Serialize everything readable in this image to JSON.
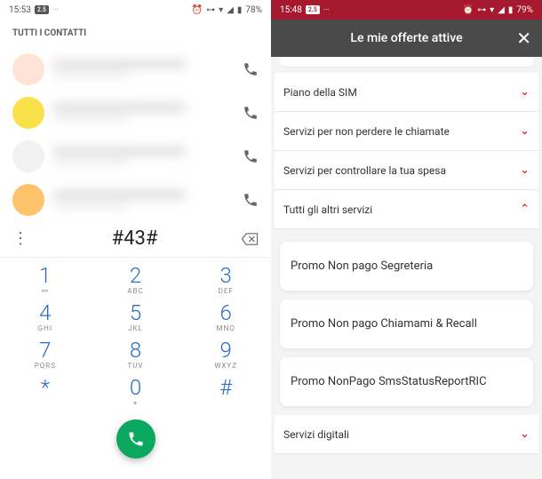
{
  "left": {
    "status": {
      "time": "15:53",
      "battery": "78%",
      "label_badge": "2.5"
    },
    "tab": "TUTTI I CONTATTI",
    "contacts": [
      {
        "color": "#ffe3d6"
      },
      {
        "color": "#f9e14a"
      },
      {
        "color": "#f2f2f2"
      },
      {
        "color": "#ffc36b"
      }
    ],
    "dial": "#43#",
    "keys": [
      [
        {
          "d": "1",
          "l": "⚯"
        },
        {
          "d": "2",
          "l": "ABC"
        },
        {
          "d": "3",
          "l": "DEF"
        }
      ],
      [
        {
          "d": "4",
          "l": "GHI"
        },
        {
          "d": "5",
          "l": "JKL"
        },
        {
          "d": "6",
          "l": "MNO"
        }
      ],
      [
        {
          "d": "7",
          "l": "PQRS"
        },
        {
          "d": "8",
          "l": "TUV"
        },
        {
          "d": "9",
          "l": "WXYZ"
        }
      ],
      [
        {
          "d": "*",
          "l": ""
        },
        {
          "d": "0",
          "l": "+"
        },
        {
          "d": "#",
          "l": ""
        }
      ]
    ]
  },
  "right": {
    "status": {
      "time": "15:48",
      "battery": "79%",
      "label_badge": "2.5"
    },
    "title": "Le mie offerte attive",
    "sections": [
      {
        "label": "Piano della SIM",
        "open": false
      },
      {
        "label": "Servizi per non perdere le chiamate",
        "open": false
      },
      {
        "label": "Servizi per controllare la tua spesa",
        "open": false
      },
      {
        "label": "Tutti gli altri servizi",
        "open": true
      }
    ],
    "cards": [
      "Promo Non pago Segreteria",
      "Promo Non pago Chiamami & Recall",
      "Promo NonPago SmsStatusReportRIC"
    ],
    "bottom_section": "Servizi digitali"
  }
}
